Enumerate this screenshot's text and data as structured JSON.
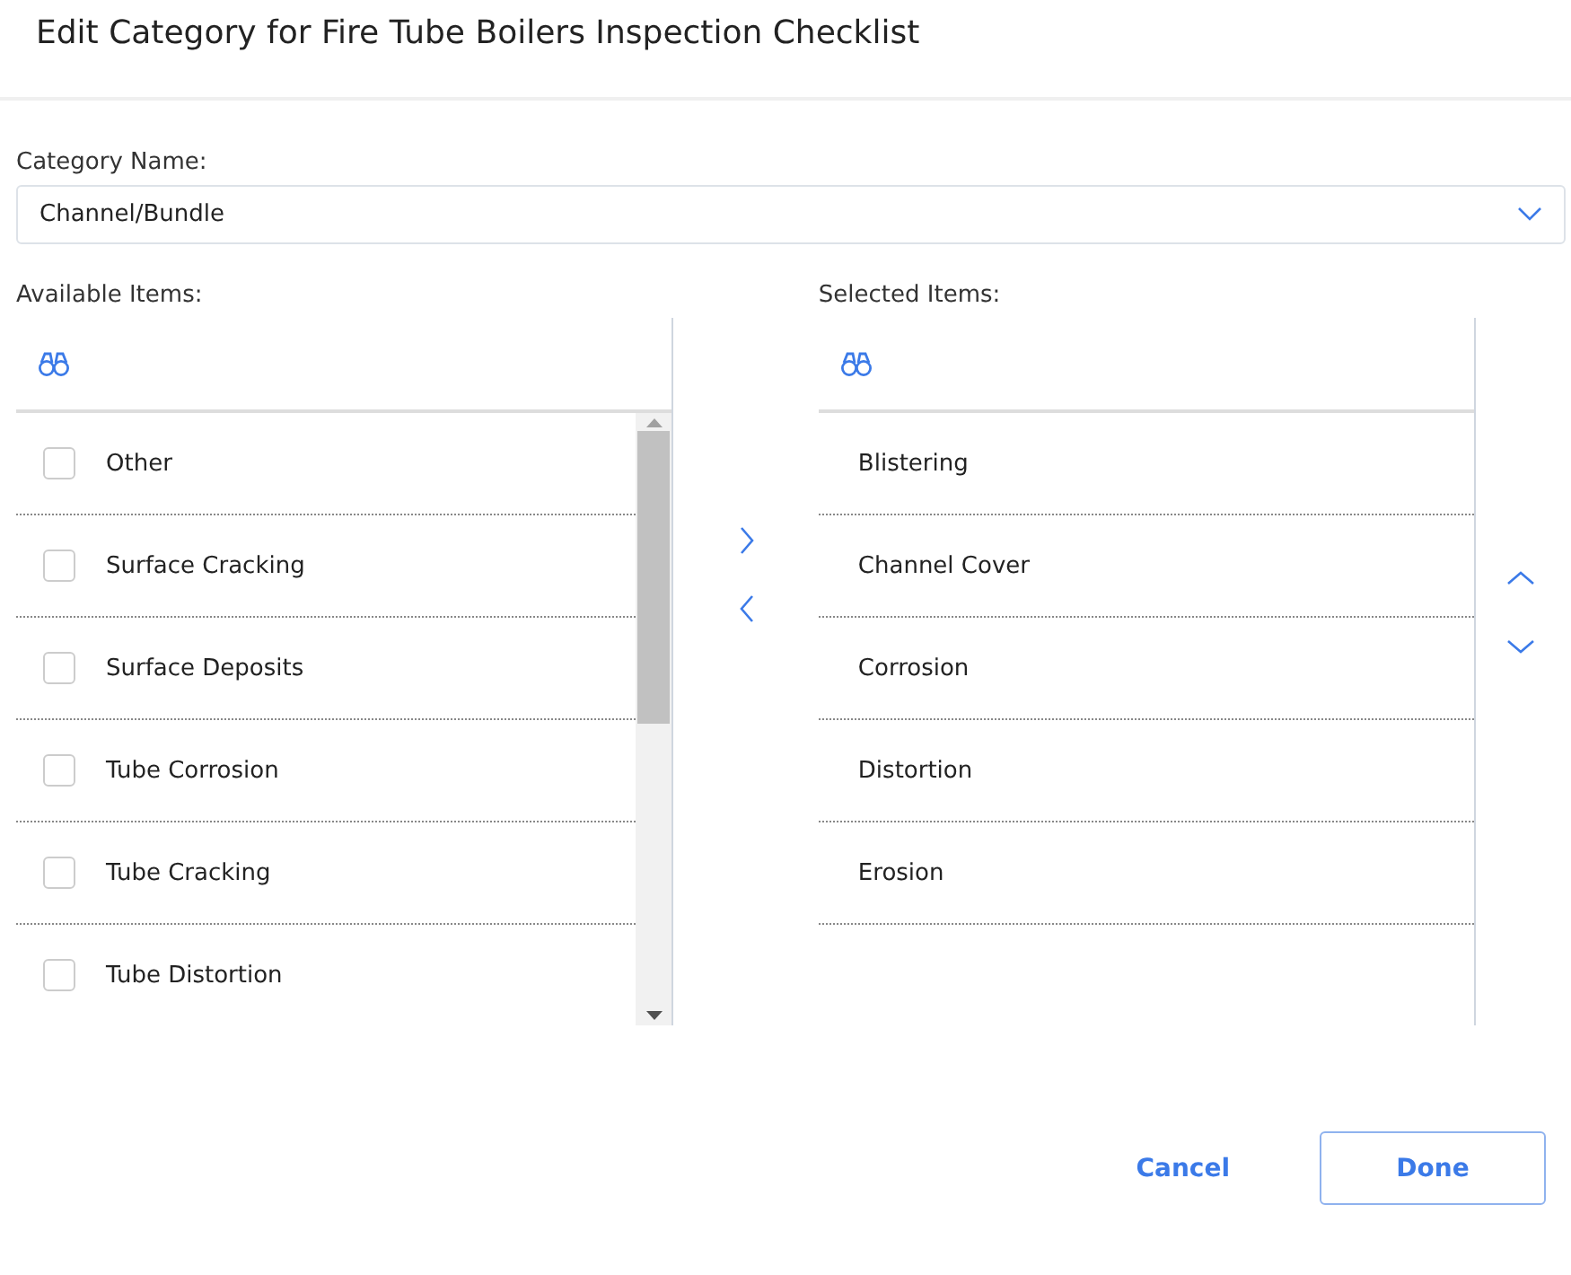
{
  "dialog": {
    "title": "Edit Category for Fire Tube Boilers Inspection Checklist"
  },
  "category": {
    "label": "Category Name:",
    "value": "Channel/Bundle"
  },
  "available": {
    "label": "Available Items:",
    "items": [
      {
        "label": "Other",
        "checked": false
      },
      {
        "label": "Surface Cracking",
        "checked": false
      },
      {
        "label": "Surface Deposits",
        "checked": false
      },
      {
        "label": "Tube Corrosion",
        "checked": false
      },
      {
        "label": "Tube Cracking",
        "checked": false
      },
      {
        "label": "Tube Distortion",
        "checked": false
      }
    ]
  },
  "selected": {
    "label": "Selected Items:",
    "items": [
      "Blistering",
      "Channel Cover",
      "Corrosion",
      "Distortion",
      "Erosion"
    ]
  },
  "buttons": {
    "cancel": "Cancel",
    "done": "Done"
  }
}
